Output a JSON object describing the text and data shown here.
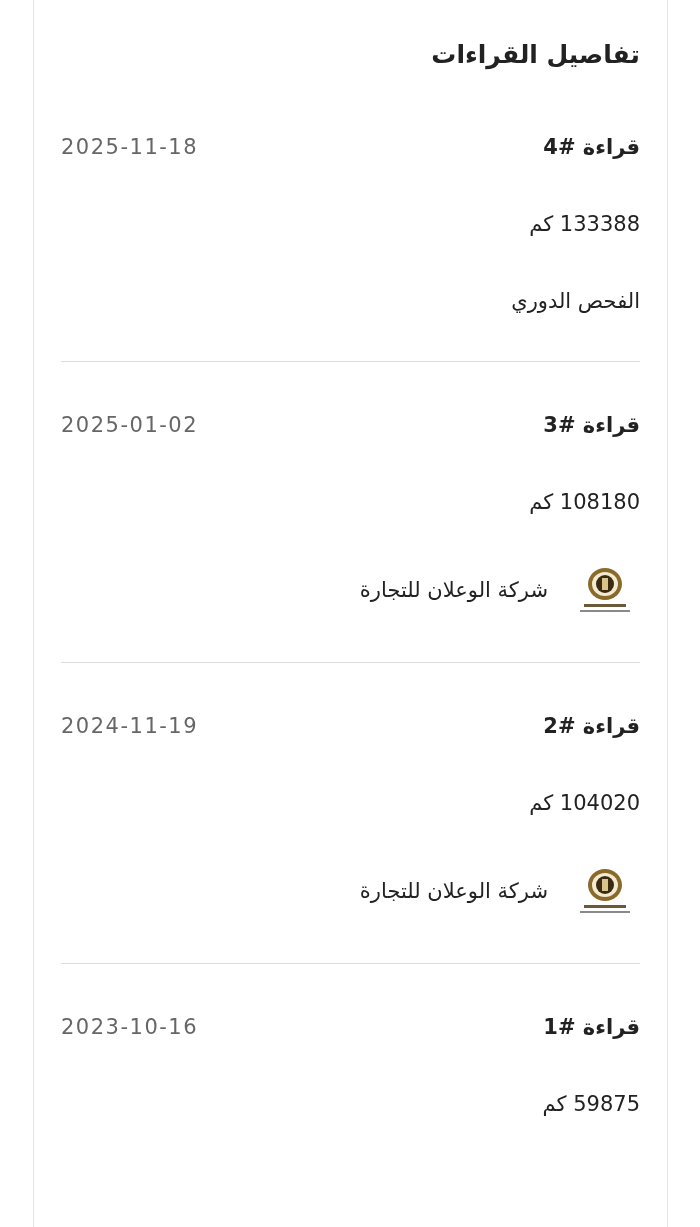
{
  "title": "تفاصيل القراءات",
  "readings": [
    {
      "name": "قراءة #4",
      "date": "2025-11-18",
      "distance": "133388 كم",
      "source": {
        "text": "الفحص الدوري",
        "logo": false
      }
    },
    {
      "name": "قراءة #3",
      "date": "2025-01-02",
      "distance": "108180 كم",
      "source": {
        "text": "شركة الوعلان للتجارة",
        "logo": true
      }
    },
    {
      "name": "قراءة #2",
      "date": "2024-11-19",
      "distance": "104020 كم",
      "source": {
        "text": "شركة الوعلان للتجارة",
        "logo": true
      }
    },
    {
      "name": "قراءة #1",
      "date": "2023-10-16",
      "distance": "59875 كم"
    }
  ]
}
